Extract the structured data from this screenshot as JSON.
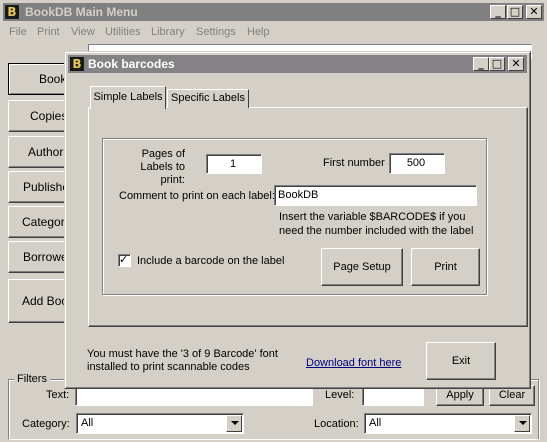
{
  "main_window": {
    "title": "BookDB Main Menu",
    "icon_glyph": "B",
    "menu": [
      "File",
      "Print",
      "View",
      "Utilities",
      "Library",
      "Settings",
      "Help"
    ],
    "sidebar_buttons": [
      "Books",
      "Copies",
      "Authors",
      "Publishers",
      "Categories",
      "Borrowers",
      "Add Books"
    ],
    "filters": {
      "legend": "Filters",
      "text_label": "Text:",
      "level_label": "Level:",
      "apply_label": "Apply",
      "clear_label": "Clear",
      "category_label": "Category:",
      "category_value": "All",
      "location_label": "Location:",
      "location_value": "All"
    }
  },
  "dialog": {
    "title": "Book barcodes",
    "icon_glyph": "B",
    "tabs": [
      "Simple Labels",
      "Specific Labels"
    ],
    "pages_label": "Pages of\nLabels to print:",
    "pages_value": "1",
    "first_number_label": "First number",
    "first_number_value": "500",
    "comment_label": "Comment to print on each label:",
    "comment_value": "BookDB",
    "hint_line1": "Insert the variable $BARCODE$ if you",
    "hint_line2": "need the number included with the label",
    "include_barcode_label": "Include a barcode on the label",
    "include_barcode_checked": true,
    "page_setup_label": "Page Setup",
    "print_label": "Print",
    "font_notice_line1": "You must have the '3 of 9 Barcode' font",
    "font_notice_line2": "installed to print scannable codes",
    "download_link": "Download font here",
    "exit_label": "Exit"
  }
}
